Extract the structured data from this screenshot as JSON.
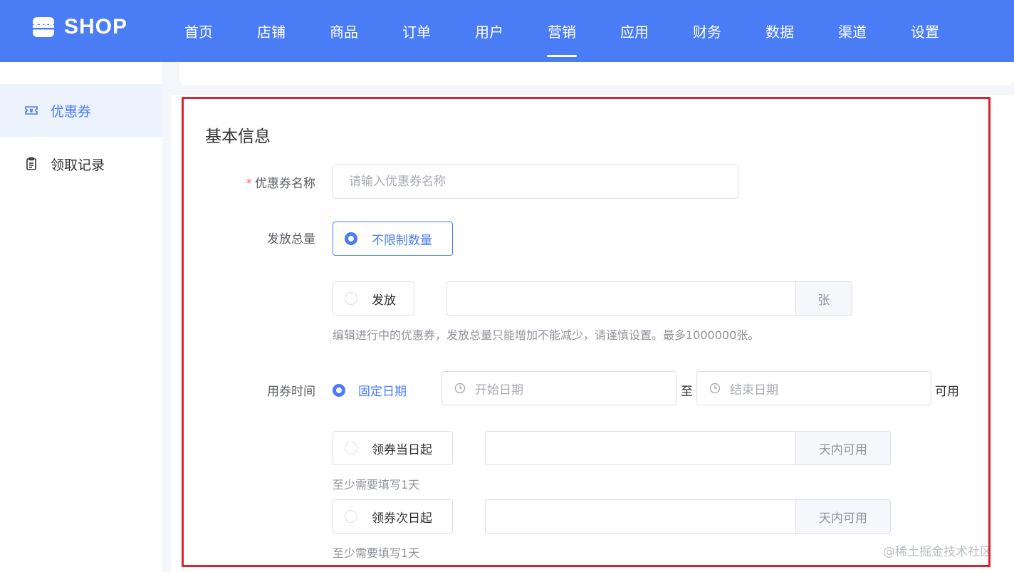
{
  "brand": {
    "name": "SHOP"
  },
  "nav": {
    "items": [
      "首页",
      "店铺",
      "商品",
      "订单",
      "用户",
      "营销",
      "应用",
      "财务",
      "数据",
      "渠道",
      "设置"
    ],
    "active": "营销"
  },
  "sidebar": {
    "items": [
      {
        "label": "优惠券",
        "icon": "ticket-icon",
        "active": true
      },
      {
        "label": "领取记录",
        "icon": "clipboard-icon",
        "active": false
      }
    ]
  },
  "form": {
    "section_title": "基本信息",
    "coupon_name": {
      "label": "优惠券名称",
      "required_mark": "*",
      "placeholder": "请输入优惠券名称",
      "value": ""
    },
    "total": {
      "label": "发放总量",
      "option_unlimited": "不限制数量",
      "option_limited": "发放",
      "unit": "张",
      "hint": "编辑进行中的优惠券，发放总量只能增加不能减少，请谨慎设置。最多1000000张。",
      "selected": "不限制数量"
    },
    "time": {
      "label": "用券时间",
      "option_fixed": "固定日期",
      "start_placeholder": "开始日期",
      "separator": "至",
      "end_placeholder": "结束日期",
      "available_suffix": "可用",
      "option_same_day": "领券当日起",
      "option_next_day": "领券次日起",
      "days_unit": "天内可用",
      "days_hint": "至少需要填写1天",
      "selected": "固定日期"
    }
  },
  "watermark": "@稀土掘金技术社区",
  "colors": {
    "primary": "#4a7cf6",
    "highlight_border": "#e0202c",
    "required": "#f56c6c"
  }
}
